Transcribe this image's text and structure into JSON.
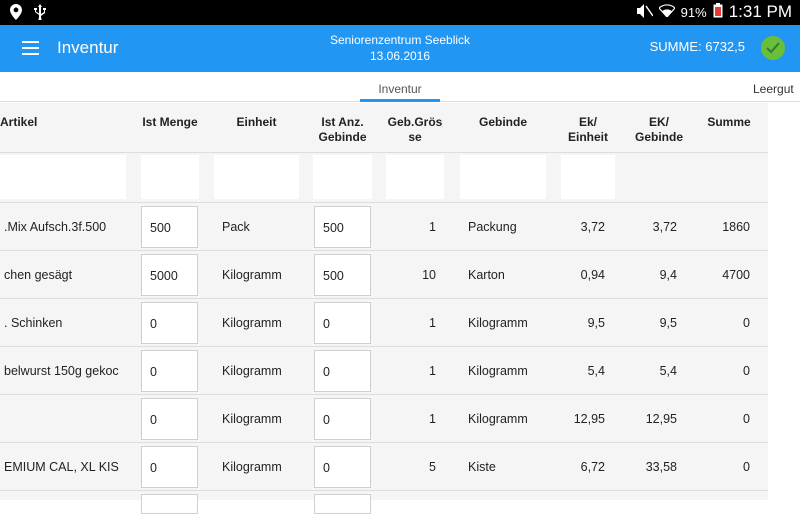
{
  "status": {
    "battery": "91%",
    "time": "1:31 PM"
  },
  "appbar": {
    "title": "Inventur",
    "center_line1": "Seniorenzentrum Seeblick",
    "center_line2": "13.06.2016",
    "summe": "SUMME: 6732,5"
  },
  "tabs": [
    {
      "label": "Inventur"
    },
    {
      "label": "Leergut"
    }
  ],
  "headers": {
    "artikel": "Artikel",
    "ist_menge": "Ist Menge",
    "einheit": "Einheit",
    "ist_anz": "Ist Anz. Gebinde",
    "geb_groesse": "Geb.Grös se",
    "gebinde": "Gebinde",
    "ek_einheit": "Ek/ Einheit",
    "ek_gebinde": "EK/ Gebinde",
    "summe": "Summe"
  },
  "rows": [
    {
      "artikel": ".Mix  Aufsch.3f.500",
      "ist_menge": "500",
      "einheit": "Pack",
      "ist_anz": "500",
      "geb": "1",
      "gebinde": "Packung",
      "ek_einheit": "3,72",
      "ek_gebinde": "3,72",
      "summe": "1860"
    },
    {
      "artikel": "chen gesägt",
      "ist_menge": "5000",
      "einheit": "Kilogramm",
      "ist_anz": "500",
      "geb": "10",
      "gebinde": "Karton",
      "ek_einheit": "0,94",
      "ek_gebinde": "9,4",
      "summe": "4700"
    },
    {
      "artikel": ". Schinken",
      "ist_menge": "0",
      "einheit": "Kilogramm",
      "ist_anz": "0",
      "geb": "1",
      "gebinde": "Kilogramm",
      "ek_einheit": "9,5",
      "ek_gebinde": "9,5",
      "summe": "0"
    },
    {
      "artikel": "belwurst 150g gekoc",
      "ist_menge": "0",
      "einheit": "Kilogramm",
      "ist_anz": "0",
      "geb": "1",
      "gebinde": "Kilogramm",
      "ek_einheit": "5,4",
      "ek_gebinde": "5,4",
      "summe": "0"
    },
    {
      "artikel": "",
      "ist_menge": "0",
      "einheit": "Kilogramm",
      "ist_anz": "0",
      "geb": "1",
      "gebinde": "Kilogramm",
      "ek_einheit": "12,95",
      "ek_gebinde": "12,95",
      "summe": "0"
    },
    {
      "artikel": "EMIUM CAL, XL  KIS",
      "ist_menge": "0",
      "einheit": "Kilogramm",
      "ist_anz": "0",
      "geb": "5",
      "gebinde": "Kiste",
      "ek_einheit": "6,72",
      "ek_gebinde": "33,58",
      "summe": "0"
    }
  ],
  "colors": {
    "appbar": "#2196f3",
    "confirm": "#6abf3a"
  },
  "icons": [
    "location-icon",
    "usb-icon",
    "mute-icon",
    "wifi-icon",
    "battery-icon",
    "menu-icon",
    "check-icon"
  ]
}
